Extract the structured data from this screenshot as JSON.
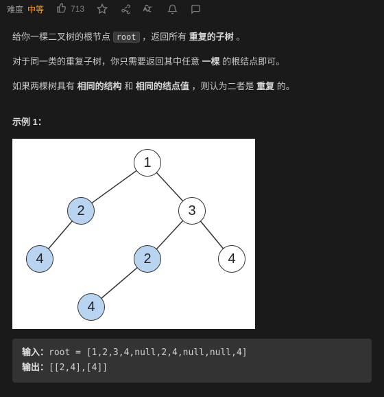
{
  "header": {
    "difficulty_label": "难度",
    "difficulty_value": "中等",
    "likes_count": "713"
  },
  "problem": {
    "p1_a": "给你一棵二叉树的根节点 ",
    "p1_code": "root",
    "p1_b": " ，返回所有 ",
    "p1_bold": "重复的子树 ",
    "p1_c": "。",
    "p2_a": "对于同一类的重复子树，你只需要返回其中任意 ",
    "p2_bold": "一棵",
    "p2_b": " 的根结点即可。",
    "p3_a": "如果两棵树具有 ",
    "p3_bold1": "相同的结构",
    "p3_b": " 和 ",
    "p3_bold2": "相同的结点值 ",
    "p3_c": "，则认为二者是 ",
    "p3_bold3": "重复",
    "p3_d": " 的。"
  },
  "example": {
    "title": "示例 1：",
    "nodes": {
      "n1": "1",
      "n2": "2",
      "n3": "3",
      "n4a": "4",
      "n2b": "2",
      "n4b": "4",
      "n4c": "4"
    },
    "input_label": "输入：",
    "input_value": "root = [1,2,3,4,null,2,4,null,null,4]",
    "output_label": "输出：",
    "output_value": "[[2,4],[4]]"
  }
}
